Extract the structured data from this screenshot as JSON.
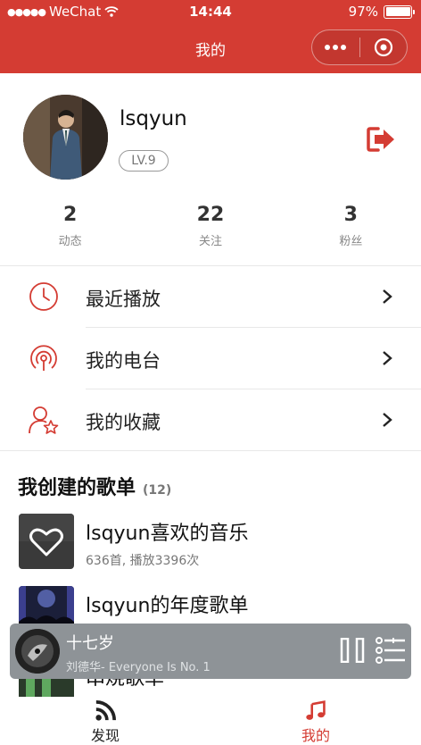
{
  "status_bar": {
    "carrier": "WeChat",
    "time": "14:44",
    "battery": "97%"
  },
  "navbar": {
    "title": "我的"
  },
  "profile": {
    "username": "lsqyun",
    "level": "LV.9"
  },
  "stats": [
    {
      "value": "2",
      "label": "动态"
    },
    {
      "value": "22",
      "label": "关注"
    },
    {
      "value": "3",
      "label": "粉丝"
    }
  ],
  "menu": [
    {
      "label": "最近播放",
      "icon": "clock-icon"
    },
    {
      "label": "我的电台",
      "icon": "radio-icon"
    },
    {
      "label": "我的收藏",
      "icon": "favorite-user-icon"
    }
  ],
  "playlists": {
    "title": "我创建的歌单",
    "count": "(12)",
    "items": [
      {
        "name": "lsqyun喜欢的音乐",
        "meta": "636首, 播放3396次"
      },
      {
        "name": "lsqyun的年度歌单",
        "meta": ""
      },
      {
        "name": "串烧歌单",
        "meta": ""
      }
    ]
  },
  "mini_player": {
    "song": "十七岁",
    "artist": "刘德华- Everyone Is No. 1"
  },
  "tabs": [
    {
      "label": "发现",
      "icon": "rss-icon"
    },
    {
      "label": "我的",
      "icon": "music-note-icon"
    }
  ],
  "colors": {
    "accent": "#d43c33",
    "player_bg": "#8e9397"
  }
}
